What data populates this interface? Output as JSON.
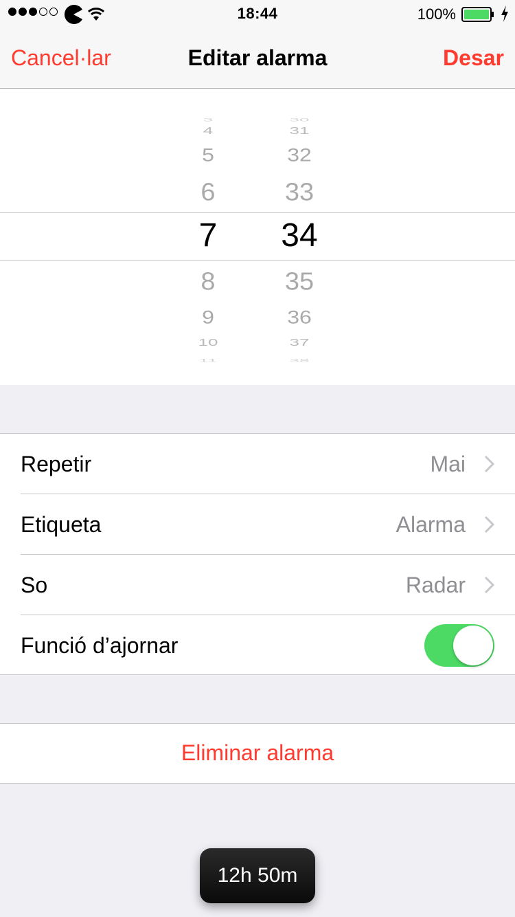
{
  "status_bar": {
    "time": "18:44",
    "battery_percent": "100%",
    "signal_bars": 3,
    "signal_total": 5,
    "carrier_icon": "pacman-icon",
    "battery_level": 1.0,
    "battery_color": "#4cd964"
  },
  "nav": {
    "cancel_label": "Cancel·lar",
    "title": "Editar alarma",
    "save_label": "Desar"
  },
  "picker": {
    "hours": [
      "3",
      "4",
      "5",
      "6",
      "7",
      "8",
      "9",
      "10",
      "11"
    ],
    "minutes": [
      "30",
      "31",
      "32",
      "33",
      "34",
      "35",
      "36",
      "37",
      "38"
    ],
    "selected_hour": "7",
    "selected_minute": "34"
  },
  "settings": {
    "repeat_label": "Repetir",
    "repeat_value": "Mai",
    "label_label": "Etiqueta",
    "label_value": "Alarma",
    "sound_label": "So",
    "sound_value": "Radar",
    "snooze_label": "Funció d’ajornar",
    "snooze_enabled": true
  },
  "delete_label": "Eliminar alarma",
  "toast_text": "12h 50m",
  "colors": {
    "accent": "#ff3b30",
    "toggle_on": "#4cd964",
    "secondary_text": "#8e8e93"
  }
}
